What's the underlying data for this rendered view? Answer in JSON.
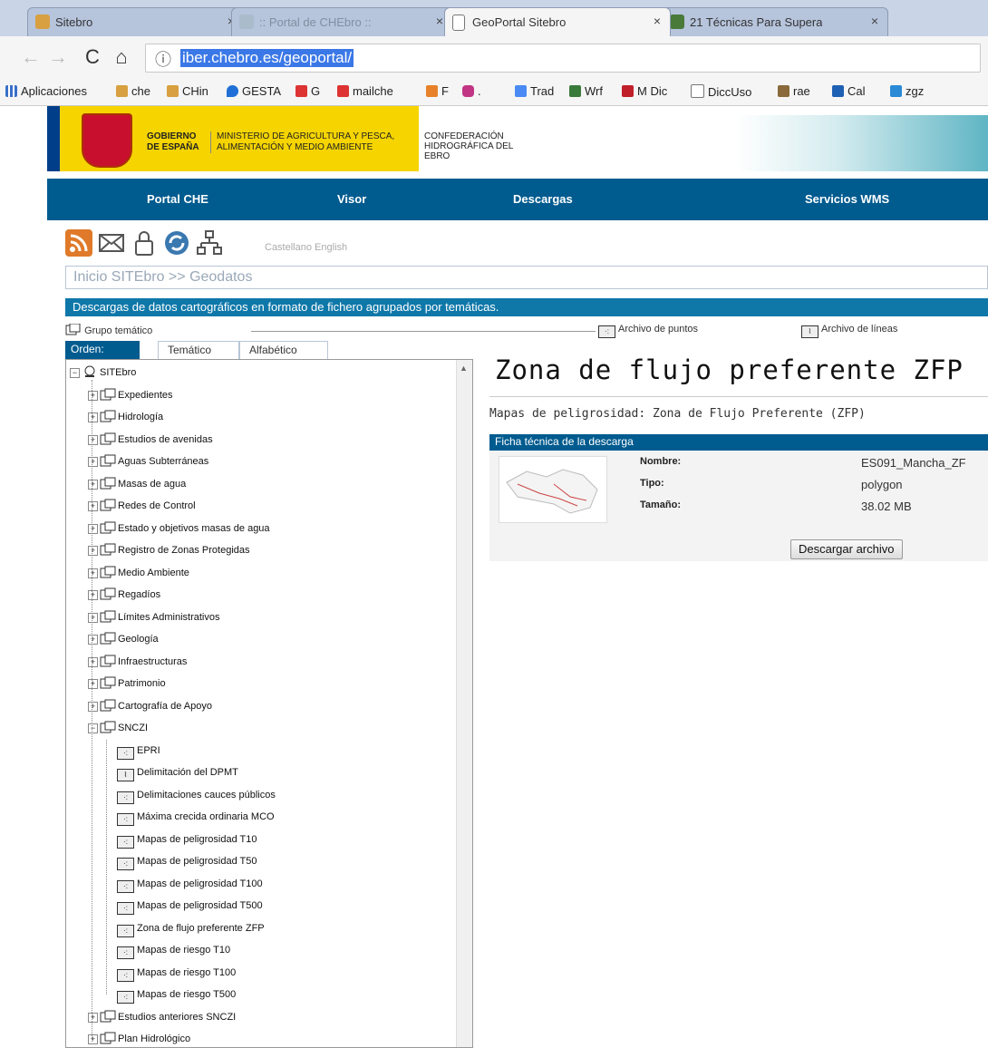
{
  "browser": {
    "tabs": [
      {
        "title": "Sitebro"
      },
      {
        "title": ":: Portal de CHEbro ::"
      },
      {
        "title": "GeoPortal Sitebro"
      },
      {
        "title": "21 Técnicas Para Supera"
      }
    ],
    "close_glyph": "×",
    "url": "iber.chebro.es/geoportal/",
    "bookmarks": [
      "Aplicaciones",
      "che",
      "CHin",
      "GESTA",
      "G",
      "mailche",
      "F",
      ".",
      "Trad",
      "Wrf",
      "M Dic",
      "DiccUso",
      "rae",
      "Cal",
      "zgz"
    ]
  },
  "header": {
    "gobierno": "GOBIERNO DE ESPAÑA",
    "ministerio": "MINISTERIO DE AGRICULTURA Y PESCA, ALIMENTACIÓN Y MEDIO AMBIENTE",
    "confederacion": "CONFEDERACIÓN HIDROGRÁFICA DEL EBRO"
  },
  "nav": [
    "Portal CHE",
    "Visor",
    "Descargas",
    "Servicios WMS"
  ],
  "languages": {
    "es": "Castellano",
    "en": "English"
  },
  "breadcrumb": "Inicio SITEbro >> Geodatos",
  "description": "Descargas de datos cartográficos en formato de fichero agrupados por temáticas.",
  "legend": {
    "group": "Grupo temático",
    "points": "Archivo de puntos",
    "lines": "Archivo de líneas"
  },
  "order_tabs": {
    "label": "Orden:",
    "tematico": "Temático",
    "alfabetico": "Alfabético"
  },
  "tree": {
    "root": "SITEbro",
    "groups": [
      "Expedientes",
      "Hidrología",
      "Estudios de avenidas",
      "Aguas Subterráneas",
      "Masas de agua",
      "Redes de Control",
      "Estado y objetivos masas de agua",
      "Registro de Zonas Protegidas",
      "Medio Ambiente",
      "Regadíos",
      "Límites Administrativos",
      "Geología",
      "Infraestructuras",
      "Patrimonio",
      "Cartografía de Apoyo",
      "SNCZI"
    ],
    "sncz_items": [
      "EPRI",
      "Delimitación del DPMT",
      "Delimitaciones cauces públicos",
      "Máxima crecida ordinaria MCO",
      "Mapas de peligrosidad T10",
      "Mapas de peligrosidad T50",
      "Mapas de peligrosidad T100",
      "Mapas de peligrosidad T500",
      "Zona de flujo preferente ZFP",
      "Mapas de riesgo T10",
      "Mapas de riesgo T100",
      "Mapas de riesgo T500"
    ],
    "after": [
      "Estudios anteriores SNCZI",
      "Plan Hidrológico"
    ]
  },
  "detail": {
    "title": "Zona de flujo preferente ZFP",
    "subtitle": "Mapas de peligrosidad: Zona de Flujo Preferente (ZFP)",
    "ficha_header": "Ficha técnica de la descarga",
    "fields": [
      {
        "label": "Nombre:",
        "value": "ES091_Mancha_ZF"
      },
      {
        "label": "Tipo:",
        "value": "polygon"
      },
      {
        "label": "Tamaño:",
        "value": "38.02 MB"
      }
    ],
    "download_button": "Descargar archivo"
  }
}
